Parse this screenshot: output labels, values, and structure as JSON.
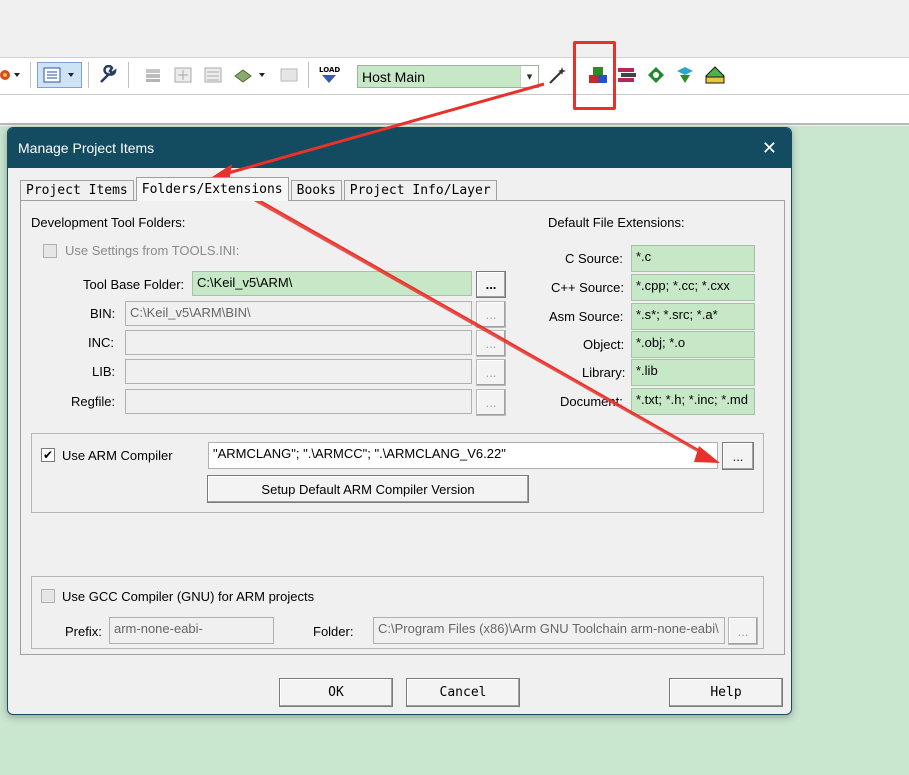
{
  "toolbar": {
    "host_select": "Host Main",
    "icons": [
      "configure-icon",
      "options-icon",
      "build-icon",
      "rebuild-icon",
      "batch-icon",
      "translate-icon",
      "load-icon",
      "wand-icon",
      "manage-project-items-icon",
      "select-packs-icon",
      "manage-rte-icon",
      "pack-installer-icon",
      "sign-icon"
    ]
  },
  "dialog": {
    "title": "Manage Project Items",
    "close": "✕",
    "tabs": [
      "Project Items",
      "Folders/Extensions",
      "Books",
      "Project Info/Layer"
    ],
    "dev_tool_folders_heading": "Development Tool Folders:",
    "use_settings_label": "Use Settings from TOOLS.INI:",
    "tool_base_folder_label": "Tool Base Folder:",
    "tool_base_folder_value": "C:\\Keil_v5\\ARM\\",
    "bin_label": "BIN:",
    "bin_value": "C:\\Keil_v5\\ARM\\BIN\\",
    "inc_label": "INC:",
    "lib_label": "LIB:",
    "regfile_label": "Regfile:",
    "browse": "...",
    "default_ext_heading": "Default File Extensions:",
    "extensions": [
      {
        "label": "C Source:",
        "value": "*.c"
      },
      {
        "label": "C++ Source:",
        "value": "*.cpp; *.cc; *.cxx"
      },
      {
        "label": "Asm Source:",
        "value": "*.s*; *.src; *.a*"
      },
      {
        "label": "Object:",
        "value": "*.obj; *.o"
      },
      {
        "label": "Library:",
        "value": "*.lib"
      },
      {
        "label": "Document:",
        "value": "*.txt; *.h; *.inc; *.md"
      }
    ],
    "use_arm_compiler_label": "Use ARM Compiler",
    "use_arm_compiler_checked": "✔",
    "arm_compiler_value": "\"ARMCLANG\"; \".\\ARMCC\"; \".\\ARMCLANG_V6.22\"",
    "setup_default_button": "Setup Default ARM Compiler Version",
    "use_gcc_label": "Use GCC Compiler (GNU) for ARM projects",
    "prefix_label": "Prefix:",
    "prefix_value": "arm-none-eabi-",
    "folder_label": "Folder:",
    "folder_value": "C:\\Program Files (x86)\\Arm GNU Toolchain arm-none-eabi\\",
    "ok_button": "OK",
    "cancel_button": "Cancel",
    "help_button": "Help"
  },
  "colors": {
    "annotation_red": "#e8312a",
    "field_green": "#c6e8c6",
    "title_bar": "#134b60",
    "workspace": "#c9e6cf"
  }
}
